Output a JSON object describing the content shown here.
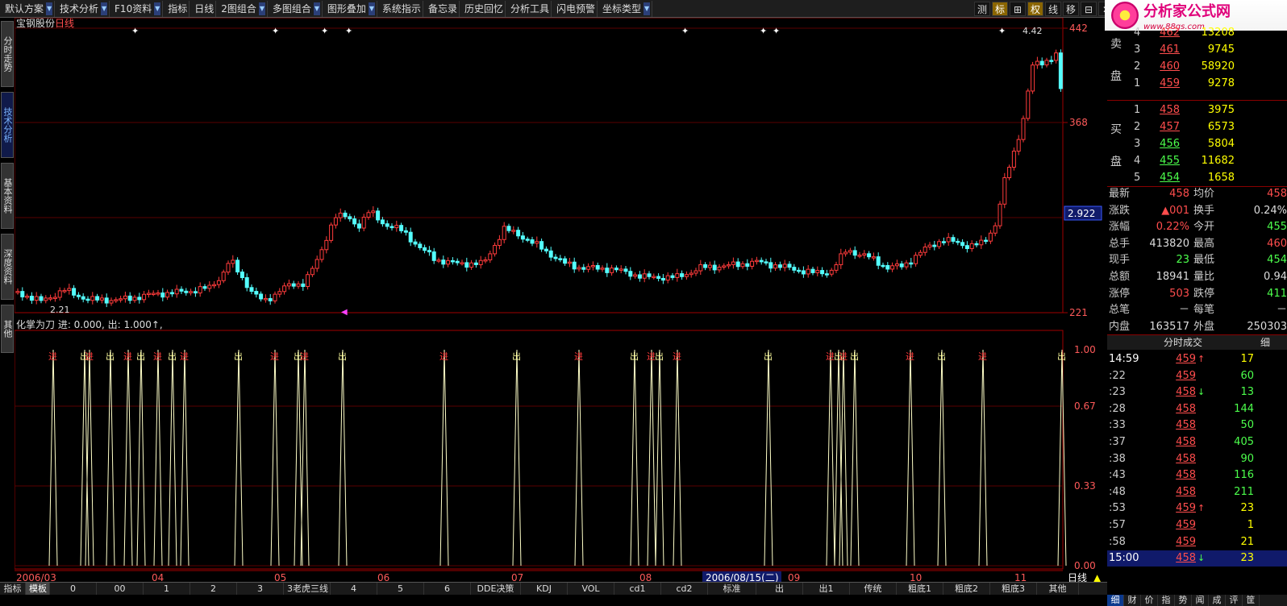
{
  "menu": [
    "默认方案",
    "技术分析",
    "F10资料",
    "指标",
    "日线",
    "2图组合",
    "多图组合",
    "图形叠加",
    "系统指示",
    "备忘录",
    "历史回忆",
    "分析工具",
    "闪电预警",
    "坐标类型"
  ],
  "right_tools": [
    "测",
    "标",
    "⊞",
    "权",
    "线",
    "移",
    "⊟",
    "✕"
  ],
  "logo": {
    "title": "分析家公式网",
    "url": "www.88gs.com"
  },
  "left_tabs": [
    "分时走势",
    "技术分析",
    "基本资料",
    "深度资料",
    "其他"
  ],
  "chart": {
    "stock_name": "宝钢股份",
    "period": "日线",
    "y_labels": [
      "442",
      "368",
      "221"
    ],
    "cursor_value": "2.922",
    "low_label": "2.21",
    "high_label": "4.42",
    "indicator_title": "化掌为刀 进: 0.000, 出: 1.000↑,",
    "ind_y_labels": [
      "1.00",
      "0.67",
      "0.33",
      "0.00"
    ],
    "date_labels": [
      "2006/03",
      "04",
      "05",
      "06",
      "07",
      "08",
      "2006/08/15(二)",
      "09",
      "10",
      "11",
      "日线"
    ],
    "signals": [
      [
        "进",
        66
      ],
      [
        "出",
        105
      ],
      [
        "进",
        111
      ],
      [
        "出",
        137
      ],
      [
        "进",
        159
      ],
      [
        "出",
        175
      ],
      [
        "进",
        196
      ],
      [
        "出",
        214
      ],
      [
        "进",
        229
      ],
      [
        "出",
        296
      ],
      [
        "进",
        341
      ],
      [
        "出",
        370
      ],
      [
        "进",
        378
      ],
      [
        "出",
        425
      ],
      [
        "进",
        551
      ],
      [
        "出",
        641
      ],
      [
        "进",
        718
      ],
      [
        "出",
        787
      ],
      [
        "进",
        808
      ],
      [
        "出",
        818
      ],
      [
        "进",
        840
      ],
      [
        "出",
        953
      ],
      [
        "进",
        1030
      ],
      [
        "出",
        1040
      ],
      [
        "进",
        1046
      ],
      [
        "出",
        1060
      ],
      [
        "进",
        1129
      ],
      [
        "出",
        1168
      ],
      [
        "进",
        1219
      ],
      [
        "出",
        1317
      ]
    ]
  },
  "colors": {
    "up": "#ff3b3b",
    "down": "#54ffff",
    "grid": "#5a0000",
    "axis": "#a00000",
    "ind_line": "#ffffc8"
  },
  "order_book": {
    "sell_label": [
      "卖",
      "盘"
    ],
    "buy_label": [
      "买",
      "盘"
    ],
    "sell": [
      [
        "4",
        "462",
        "13208"
      ],
      [
        "3",
        "461",
        "9745"
      ],
      [
        "2",
        "460",
        "58920"
      ],
      [
        "1",
        "459",
        "9278"
      ]
    ],
    "buy": [
      [
        "1",
        "458",
        "3975"
      ],
      [
        "2",
        "457",
        "6573"
      ],
      [
        "3",
        "456",
        "5804"
      ],
      [
        "4",
        "455",
        "11682"
      ],
      [
        "5",
        "454",
        "1658"
      ]
    ]
  },
  "stats": [
    [
      "最新",
      "458",
      "red",
      "均价",
      "458",
      "red"
    ],
    [
      "涨跌",
      "▲001",
      "red",
      "换手",
      "0.24%",
      "white"
    ],
    [
      "涨幅",
      "0.22%",
      "red",
      "今开",
      "455",
      "green"
    ],
    [
      "总手",
      "413820",
      "white",
      "最高",
      "460",
      "red"
    ],
    [
      "现手",
      "23",
      "green",
      "最低",
      "454",
      "green"
    ],
    [
      "总额",
      "18941",
      "white",
      "量比",
      "0.94",
      "white"
    ],
    [
      "涨停",
      "503",
      "red",
      "跌停",
      "411",
      "green"
    ],
    [
      "总笔",
      "－",
      "white",
      "每笔",
      "－",
      "white"
    ],
    [
      "内盘",
      "163517",
      "white",
      "外盘",
      "250303",
      "white"
    ]
  ],
  "ticks_title": "分时成交",
  "ticks_detail": "细",
  "ticks": [
    [
      "14:59",
      "459",
      "↑",
      "17",
      "yel"
    ],
    [
      ":22",
      "459",
      "",
      "60",
      "green"
    ],
    [
      ":23",
      "458",
      "↓",
      "13",
      "green"
    ],
    [
      ":28",
      "458",
      "",
      "144",
      "green"
    ],
    [
      ":33",
      "458",
      "",
      "50",
      "green"
    ],
    [
      ":37",
      "458",
      "",
      "405",
      "green"
    ],
    [
      ":38",
      "458",
      "",
      "90",
      "green"
    ],
    [
      ":43",
      "458",
      "",
      "116",
      "green"
    ],
    [
      ":48",
      "458",
      "",
      "211",
      "green"
    ],
    [
      ":53",
      "459",
      "↑",
      "23",
      "yel"
    ],
    [
      ":57",
      "459",
      "",
      "1",
      "yel"
    ],
    [
      ":58",
      "459",
      "",
      "21",
      "yel"
    ],
    [
      "15:00",
      "458",
      "↓",
      "23",
      "yel"
    ]
  ],
  "bottom_tabs": [
    "指标",
    "模板",
    "0",
    "00",
    "1",
    "2",
    "3",
    "3老虎三线",
    "4",
    "5",
    "6",
    "DDE决策",
    "KDJ",
    "VOL",
    "cd1",
    "cd2",
    "标准",
    "出",
    "出1",
    "传统",
    "粗底1",
    "粗底2",
    "粗底3",
    "其他"
  ],
  "right_tabs": [
    "细",
    "财",
    "价",
    "指",
    "势",
    "闻",
    "成",
    "评",
    "筐"
  ]
}
